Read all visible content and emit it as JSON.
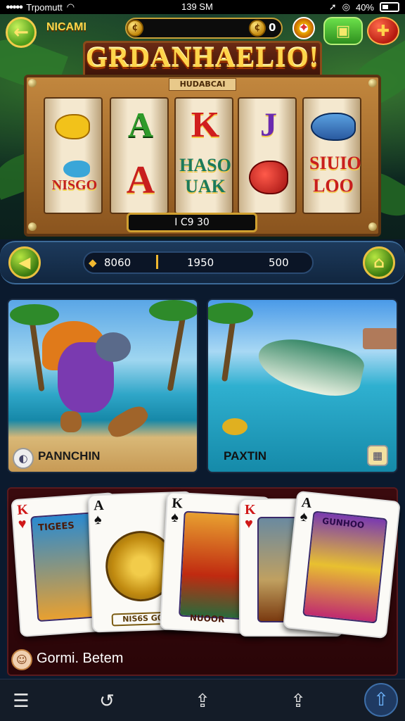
{
  "status_bar": {
    "carrier": "Trpomutt",
    "time": "139 SM",
    "battery": "40%"
  },
  "header": {
    "back_icon": "arrow-left-icon",
    "game_name": "NICAMI",
    "coin_value": "0",
    "settings_icon": "gear-icon",
    "shop_icon": "gift-icon",
    "menu_icon": "plus-icon"
  },
  "slot": {
    "title": "GRDANHAELIO!",
    "sub_label": "HUDABCAI",
    "reels": [
      {
        "top": "fish",
        "mid_text": "NISGO",
        "mid_color": "#c32020"
      },
      {
        "top": "A",
        "mid_text": "A",
        "mid_color": "#c81e1e"
      },
      {
        "top": "K",
        "mid_text": "HASO UAK",
        "mid_color": "#1b7a5a"
      },
      {
        "top": "J",
        "mid_text": "fish",
        "mid_color": "#c81e1e"
      },
      {
        "top": "fish",
        "mid_text": "SIUIO LOO",
        "mid_color": "#c81e1e"
      }
    ],
    "spin_readout": "I   C9   30"
  },
  "nav": {
    "left_icon": "arrow-left-icon",
    "right_icon": "home-icon",
    "stat1": "8060",
    "stat2": "1950",
    "stat3": "500"
  },
  "games": [
    {
      "name": "PANNCHIN",
      "icon": "shell-icon"
    },
    {
      "name": "PAXTIN",
      "icon": "info-icon"
    }
  ],
  "cards": {
    "label": "Gormi. Betem",
    "icon": "character-icon",
    "items": [
      {
        "rank": "K",
        "suit": "♥",
        "color": "#d01818",
        "badge": "TIGEES"
      },
      {
        "rank": "A",
        "suit": "♠",
        "color": "#111111",
        "badge": "NIS6S G0S"
      },
      {
        "rank": "K",
        "suit": "♠",
        "color": "#111111",
        "badge": "NUOOR"
      },
      {
        "rank": "K",
        "suit": "♥",
        "color": "#d01818",
        "badge": ""
      },
      {
        "rank": "A",
        "suit": "♠",
        "color": "#111111",
        "badge": "GUNHOO"
      }
    ]
  },
  "bottom_bar": {
    "items": [
      "menu-icon",
      "back-icon",
      "share-icon",
      "share-icon",
      "upload-icon"
    ]
  }
}
